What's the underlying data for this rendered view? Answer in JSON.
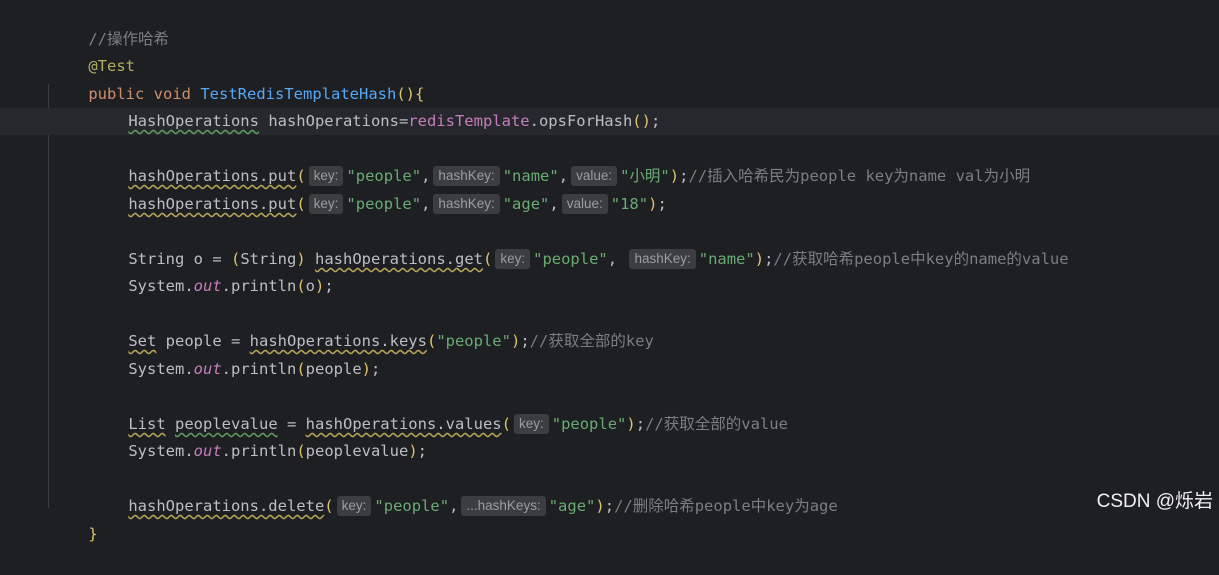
{
  "editor": {
    "lines": {
      "comment_hash": "//操作哈希",
      "annotation": "@Test",
      "method_decl": {
        "kw_public": "public",
        "kw_void": "void",
        "method_name": "TestRedisTemplateHash",
        "parens": "()",
        "brace": "{"
      },
      "decl": {
        "type": "HashOperations",
        "var": " hashOperations=",
        "field": "redisTemplate",
        "call": ".opsForHash",
        "parens": "()",
        "semi": ";"
      },
      "put1": {
        "call": "hashOperations.put",
        "open": "(",
        "hint_key": "key:",
        "arg1": "\"people\"",
        "comma1": ",",
        "hint_hashkey": "hashKey:",
        "arg2": "\"name\"",
        "comma2": ",",
        "hint_value": "value:",
        "arg3": "\"小明\"",
        "close": ")",
        "semi": ";",
        "comment": "//插入哈希民为people key为name val为小明"
      },
      "put2": {
        "call": "hashOperations.put",
        "open": "(",
        "hint_key": "key:",
        "arg1": "\"people\"",
        "comma1": ",",
        "hint_hashkey": "hashKey:",
        "arg2": "\"age\"",
        "comma2": ",",
        "hint_value": "value:",
        "arg3": "\"18\"",
        "close": ")",
        "semi": ";"
      },
      "get": {
        "prefix": "String o = ",
        "cast_open": "(",
        "cast_type": "String",
        "cast_close": ")",
        "space": " ",
        "call": "hashOperations.get",
        "open": "(",
        "hint_key": "key:",
        "arg1": "\"people\"",
        "comma1": ", ",
        "hint_hashkey": "hashKey:",
        "arg2": "\"name\"",
        "close": ")",
        "semi": ";",
        "comment": "//获取哈希people中key的name的value"
      },
      "print1": {
        "system": "System.",
        "out": "out",
        "rest": ".println",
        "open": "(",
        "arg": "o",
        "close": ")",
        "semi": ";"
      },
      "keys": {
        "type": "Set",
        "var": " people = ",
        "call": "hashOperations.keys",
        "open": "(",
        "arg1": "\"people\"",
        "close": ")",
        "semi": ";",
        "comment": "//获取全部的key"
      },
      "print2": {
        "system": "System.",
        "out": "out",
        "rest": ".println",
        "open": "(",
        "arg": "people",
        "close": ")",
        "semi": ";"
      },
      "values": {
        "type": "List",
        "space": " ",
        "var": "peoplevalue",
        "eq": " = ",
        "call": "hashOperations.values",
        "open": "(",
        "hint_key": "key:",
        "arg1": "\"people\"",
        "close": ")",
        "semi": ";",
        "comment": "//获取全部的value"
      },
      "print3": {
        "system": "System.",
        "out": "out",
        "rest": ".println",
        "open": "(",
        "arg": "peoplevalue",
        "close": ")",
        "semi": ";"
      },
      "delete": {
        "call": "hashOperations.delete",
        "open": "(",
        "hint_key": "key:",
        "arg1": "\"people\"",
        "comma1": ",",
        "hint_hashkeys": "...hashKeys:",
        "arg2": "\"age\"",
        "close": ")",
        "semi": ";",
        "comment": "//删除哈希people中key为age"
      },
      "close_brace": "}"
    }
  },
  "watermark": "CSDN @烁岩",
  "colors": {
    "background": "#1e1f22",
    "keyword": "#cf8e6d",
    "string": "#6aab73",
    "comment": "#7a7e85",
    "method": "#56a8f5",
    "field": "#c77dbb",
    "annotation": "#b3ae60"
  }
}
